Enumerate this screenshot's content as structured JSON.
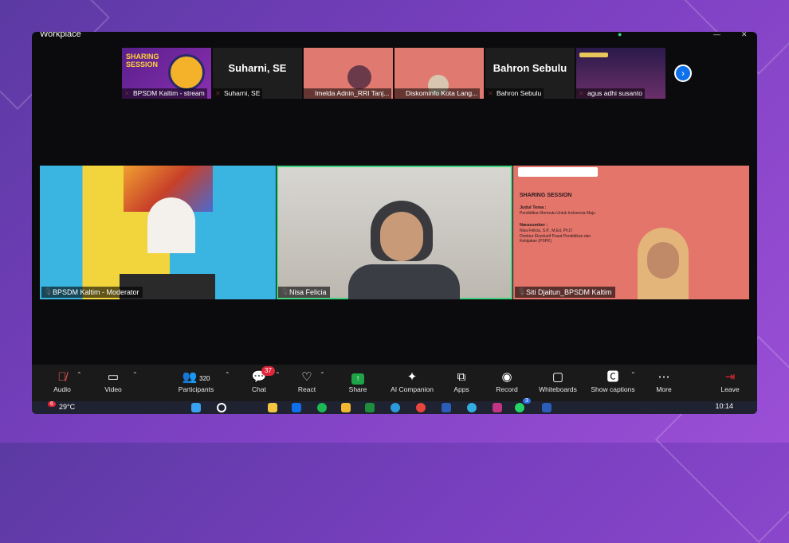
{
  "window": {
    "title": "Workplace"
  },
  "strip": {
    "thumbnails": [
      {
        "name": "BPSDM Kaltim - stream",
        "kind": "slide",
        "slide_title": "SHARING SESSION"
      },
      {
        "name": "Suharni, SE",
        "kind": "text",
        "big_name": "Suharni, SE"
      },
      {
        "name": "Imelda Adnin_RRI Tanj...",
        "kind": "video"
      },
      {
        "name": "Diskominfo Kota Lang...",
        "kind": "video"
      },
      {
        "name": "Bahron Sebulu",
        "kind": "text",
        "big_name": "Bahron Sebulu"
      },
      {
        "name": "agus adhi susanto",
        "kind": "slide"
      }
    ]
  },
  "gallery": {
    "tiles": [
      {
        "name": "BPSDM Kaltim - Moderator"
      },
      {
        "name": "Nisa Felicia",
        "active": true
      },
      {
        "name": "Siti Djaitun_BPSDM Kaltim",
        "slide_heading": "SHARING SESSION",
        "slide_label1": "Judul Tema :",
        "slide_text1": "Pendidikan Bermutu Untuk Indonesia Maju",
        "slide_label2": "Narasumber :",
        "slide_text2": "Nisa Felicia, S.P., M.Ed, Ph.D",
        "slide_text3": "Direktur Eksekutif Pusat Pendidikan dan Kebijakan (PSPK)"
      }
    ]
  },
  "toolbar": {
    "audio": "Audio",
    "video": "Video",
    "participants": "Participants",
    "participants_count": "320",
    "chat": "Chat",
    "chat_badge": "37",
    "react": "React",
    "share": "Share",
    "ai": "AI Companion",
    "apps": "Apps",
    "record": "Record",
    "whiteboards": "Whiteboards",
    "captions": "Show captions",
    "more": "More",
    "leave": "Leave"
  },
  "taskbar": {
    "weather_badge": "6",
    "weather": "29°C",
    "clock": "10:14",
    "app_badge": "3"
  },
  "colors": {
    "accent": "#0e71eb",
    "active_border": "#3fd27c",
    "leave": "#e0263a"
  }
}
